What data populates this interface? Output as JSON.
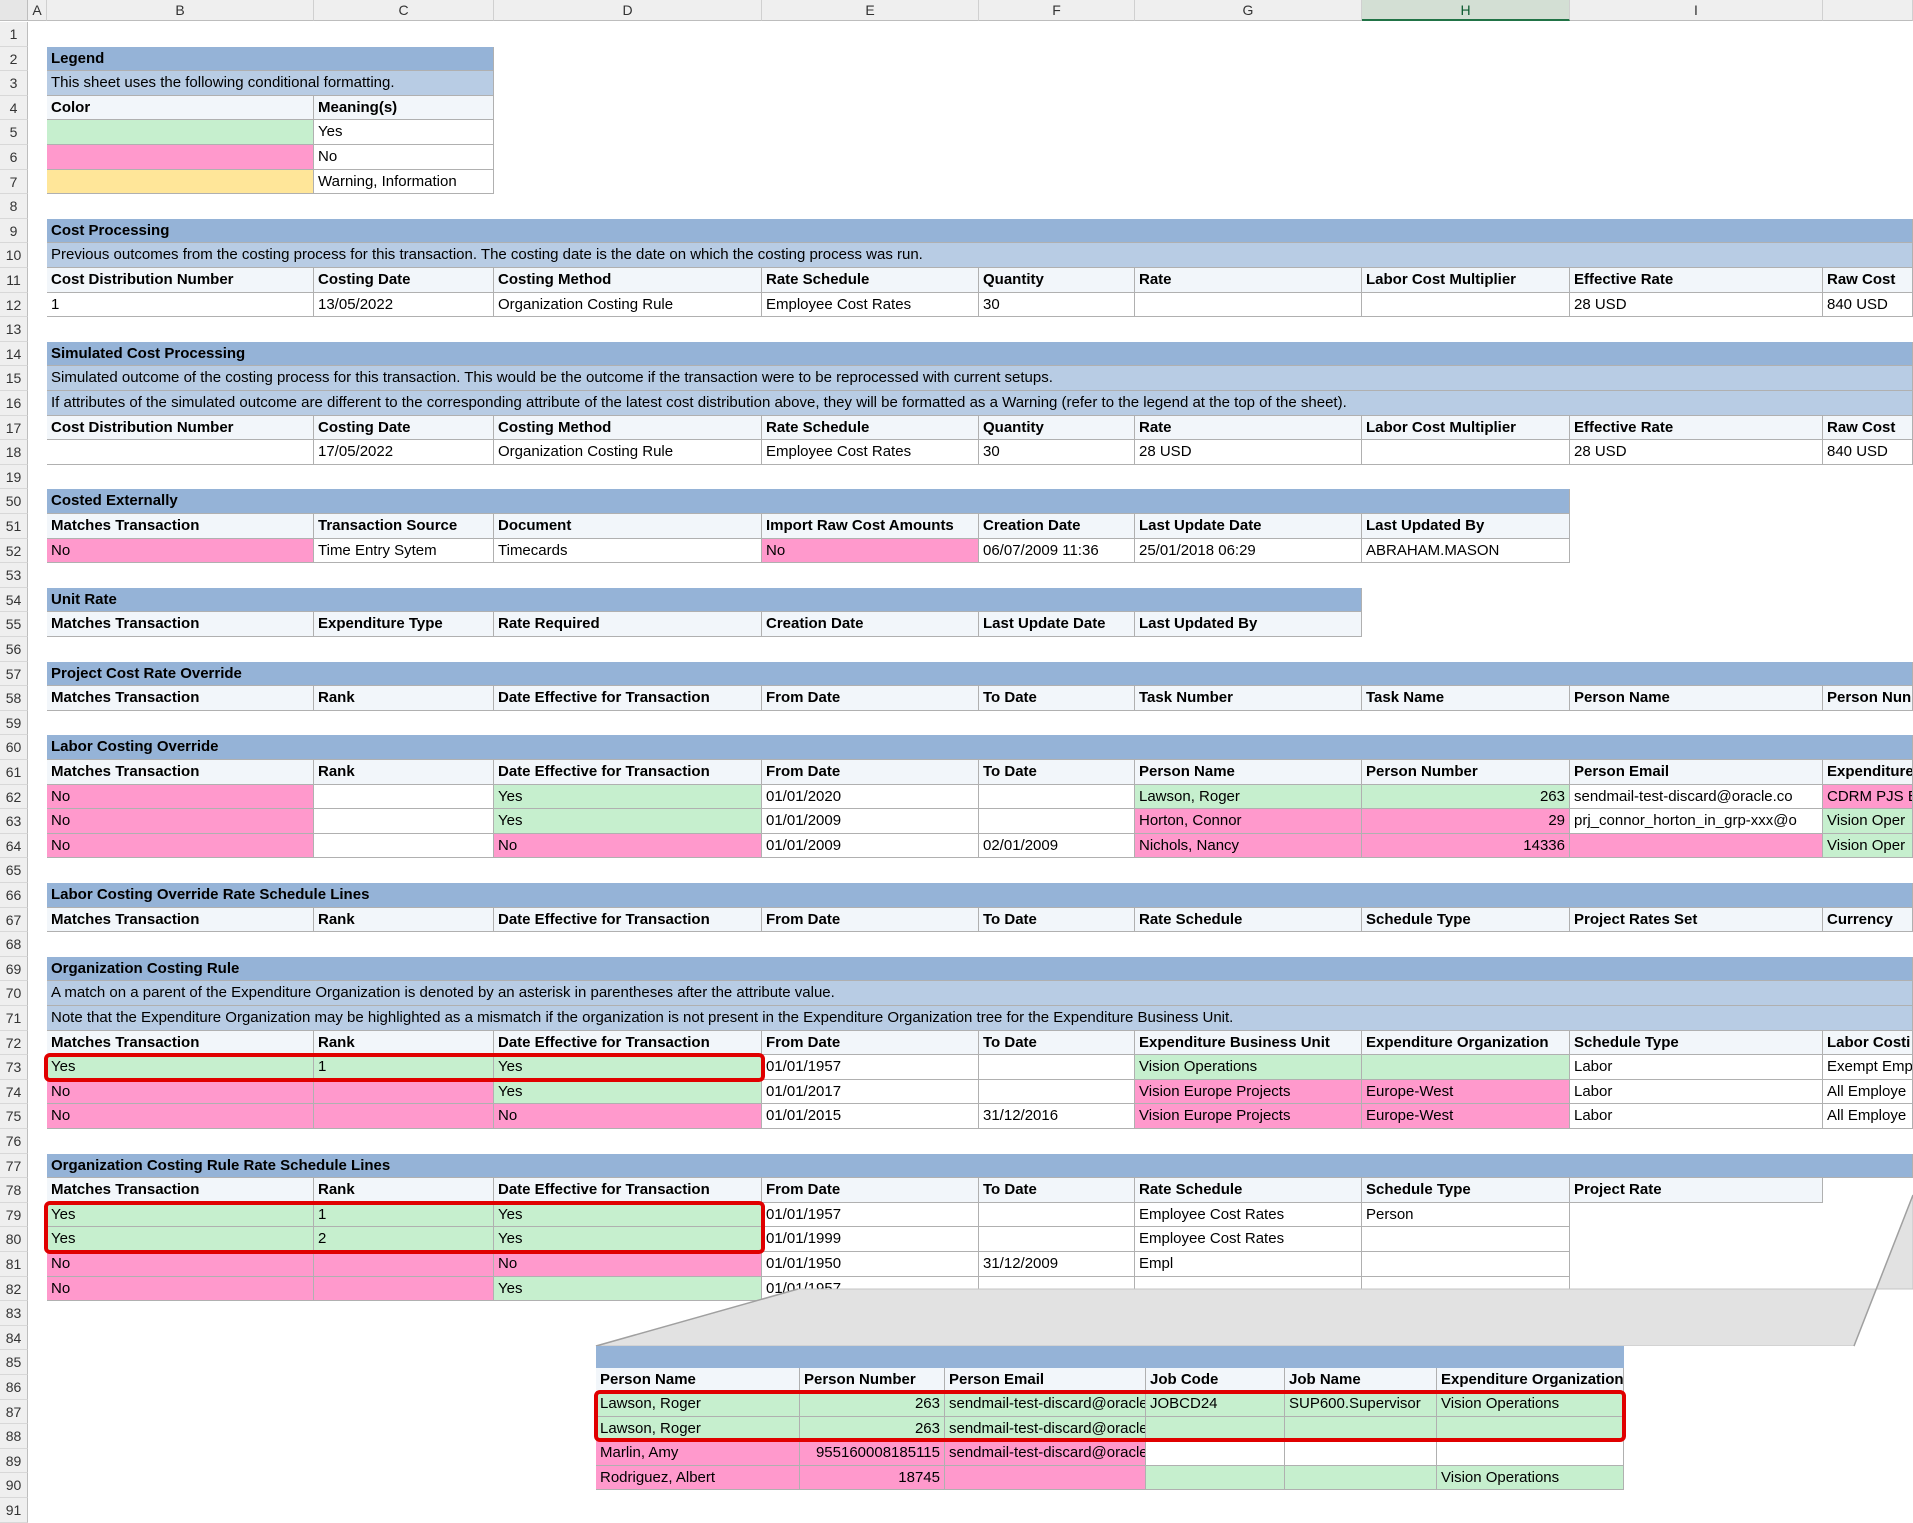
{
  "columns": [
    "A",
    "B",
    "C",
    "D",
    "E",
    "F",
    "G",
    "H",
    "I"
  ],
  "rows": [
    "1",
    "2",
    "3",
    "4",
    "5",
    "6",
    "7",
    "8",
    "9",
    "10",
    "11",
    "12",
    "13",
    "14",
    "15",
    "16",
    "17",
    "18",
    "19",
    "50",
    "51",
    "52",
    "53",
    "54",
    "55",
    "56",
    "57",
    "58",
    "59",
    "60",
    "61",
    "62",
    "63",
    "64",
    "65",
    "66",
    "67",
    "68",
    "69",
    "70",
    "71",
    "72",
    "73",
    "74",
    "75",
    "76",
    "77",
    "78",
    "79",
    "80",
    "81",
    "82",
    "83",
    "84",
    "85",
    "86",
    "87",
    "88",
    "89",
    "90",
    "91"
  ],
  "legend": {
    "title": "Legend",
    "description": "This sheet uses the following conditional formatting.",
    "header": [
      "Color",
      "Meaning(s)"
    ],
    "items": [
      {
        "meaning": "Yes",
        "color": "#c6efce"
      },
      {
        "meaning": "No",
        "color": "#ff99cc"
      },
      {
        "meaning": "Warning, Information",
        "color": "#ffe699"
      }
    ]
  },
  "cost_processing": {
    "title": "Cost Processing",
    "description": "Previous outcomes from the costing process for this transaction. The costing date is the date on which the costing process was run.",
    "headers": [
      "Cost Distribution Number",
      "Costing Date",
      "Costing Method",
      "Rate Schedule",
      "Quantity",
      "Rate",
      "Labor Cost Multiplier",
      "Effective Rate",
      "Raw Cost"
    ],
    "row": [
      "1",
      "13/05/2022",
      "Organization Costing Rule",
      "Employee Cost Rates",
      "30",
      "",
      "",
      "28 USD",
      "840 USD"
    ]
  },
  "simulated": {
    "title": "Simulated Cost Processing",
    "description1": "Simulated outcome of the costing process for this transaction. This would be the outcome if the transaction were to be reprocessed with current setups.",
    "description2": "If attributes of the simulated outcome are different to the corresponding attribute of the latest cost distribution above, they will be formatted as a Warning (refer to the legend at the top of the sheet).",
    "headers": [
      "Cost Distribution Number",
      "Costing Date",
      "Costing Method",
      "Rate Schedule",
      "Quantity",
      "Rate",
      "Labor Cost Multiplier",
      "Effective Rate",
      "Raw Cost"
    ],
    "row": [
      "",
      "17/05/2022",
      "Organization Costing Rule",
      "Employee Cost Rates",
      "30",
      "28 USD",
      "",
      "28 USD",
      "840 USD"
    ]
  },
  "costed_externally": {
    "title": "Costed Externally",
    "headers": [
      "Matches Transaction",
      "Transaction Source",
      "Document",
      "Import Raw Cost Amounts",
      "Creation Date",
      "Last Update Date",
      "Last Updated By"
    ],
    "row": [
      "No",
      "Time Entry Sytem",
      "Timecards",
      "No",
      "06/07/2009 11:36",
      "25/01/2018 06:29",
      "ABRAHAM.MASON"
    ]
  },
  "unit_rate": {
    "title": "Unit Rate",
    "headers": [
      "Matches Transaction",
      "Expenditure Type",
      "Rate Required",
      "Creation Date",
      "Last Update Date",
      "Last Updated By"
    ]
  },
  "project_override": {
    "title": "Project Cost Rate Override",
    "headers": [
      "Matches Transaction",
      "Rank",
      "Date Effective for Transaction",
      "From Date",
      "To Date",
      "Task Number",
      "Task Name",
      "Person Name",
      "Person Nun"
    ]
  },
  "labor_override": {
    "title": "Labor Costing Override",
    "headers": [
      "Matches Transaction",
      "Rank",
      "Date Effective for Transaction",
      "From Date",
      "To Date",
      "Person Name",
      "Person Number",
      "Person Email",
      "Expenditure"
    ],
    "rows": [
      [
        "No",
        "",
        "Yes",
        "01/01/2020",
        "",
        "Lawson, Roger",
        "263",
        "sendmail-test-discard@oracle.co",
        "CDRM PJS B"
      ],
      [
        "No",
        "",
        "Yes",
        "01/01/2009",
        "",
        "Horton, Connor",
        "29",
        "prj_connor_horton_in_grp-xxx@o",
        "Vision Oper"
      ],
      [
        "No",
        "",
        "No",
        "01/01/2009",
        "02/01/2009",
        "Nichols, Nancy",
        "14336",
        "",
        "Vision Oper"
      ]
    ]
  },
  "labor_override_lines": {
    "title": "Labor Costing Override Rate Schedule Lines",
    "headers": [
      "Matches Transaction",
      "Rank",
      "Date Effective for Transaction",
      "From Date",
      "To Date",
      "Rate Schedule",
      "Schedule Type",
      "Project Rates Set",
      "Currency"
    ]
  },
  "org_rule": {
    "title": "Organization Costing Rule",
    "description1": "A match on a parent of the Expenditure Organization is denoted by an asterisk in parentheses after the attribute value.",
    "description2": "Note that the Expenditure Organization may be highlighted as a mismatch if the organization is not present in the Expenditure Organization tree for the Expenditure Business Unit.",
    "headers": [
      "Matches Transaction",
      "Rank",
      "Date Effective for Transaction",
      "From Date",
      "To Date",
      "Expenditure Business Unit",
      "Expenditure Organization",
      "Schedule Type",
      "Labor Costi"
    ],
    "rows": [
      [
        "Yes",
        "1",
        "Yes",
        "01/01/1957",
        "",
        "Vision Operations",
        "",
        "Labor",
        "Exempt Emp"
      ],
      [
        "No",
        "",
        "Yes",
        "01/01/2017",
        "",
        "Vision Europe Projects",
        "Europe-West",
        "Labor",
        "All Employe"
      ],
      [
        "No",
        "",
        "No",
        "01/01/2015",
        "31/12/2016",
        "Vision Europe Projects",
        "Europe-West",
        "Labor",
        "All Employe"
      ]
    ]
  },
  "org_rule_lines": {
    "title": "Organization Costing Rule Rate Schedule Lines",
    "headers": [
      "Matches Transaction",
      "Rank",
      "Date Effective for Transaction",
      "From Date",
      "To Date",
      "Rate Schedule",
      "Schedule Type",
      "Project Rate"
    ],
    "rows": [
      [
        "Yes",
        "1",
        "Yes",
        "01/01/1957",
        "",
        "Employee Cost Rates",
        "Person"
      ],
      [
        "Yes",
        "2",
        "Yes",
        "01/01/1999",
        "",
        "Employee Cost Rates",
        ""
      ],
      [
        "No",
        "",
        "No",
        "01/01/1950",
        "31/12/2009",
        "Empl",
        ""
      ],
      [
        "No",
        "",
        "Yes",
        "01/01/1957",
        "",
        "",
        ""
      ]
    ]
  },
  "zoom_callout": {
    "headers": [
      "Person Name",
      "Person Number",
      "Person Email",
      "Job Code",
      "Job Name",
      "Expenditure Organization"
    ],
    "rows": [
      [
        "Lawson, Roger",
        "263",
        "sendmail-test-discard@oracle.cc",
        "JOBCD24",
        "SUP600.Supervisor",
        "Vision Operations"
      ],
      [
        "Lawson, Roger",
        "263",
        "sendmail-test-discard@oracle.com",
        "",
        "",
        ""
      ],
      [
        "Marlin, Amy",
        "955160008185115",
        "sendmail-test-discard@oracle.com",
        "",
        "",
        ""
      ],
      [
        "Rodriguez, Albert",
        "18745",
        "",
        "",
        "",
        "Vision Operations"
      ]
    ]
  }
}
